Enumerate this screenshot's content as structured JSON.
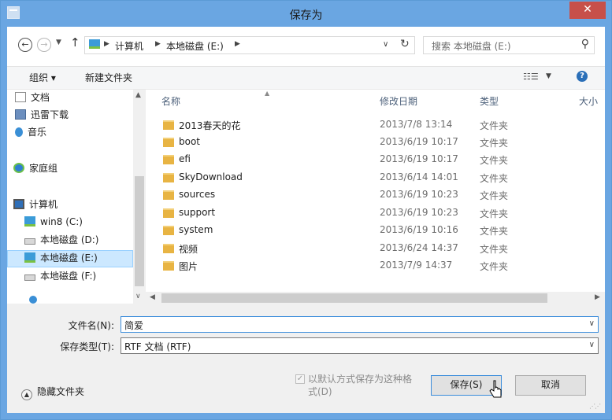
{
  "window": {
    "title": "保存为",
    "close_glyph": "✕"
  },
  "address_bar": {
    "path": [
      "计算机",
      "本地磁盘 (E:)"
    ],
    "search_placeholder": "搜索 本地磁盘 (E:)"
  },
  "toolbar": {
    "organize": "组织 ▾",
    "new_folder": "新建文件夹"
  },
  "nav_pane": {
    "items": [
      {
        "label": "文档",
        "icon": "document-icon"
      },
      {
        "label": "迅雷下载",
        "icon": "download-folder-icon"
      },
      {
        "label": "音乐",
        "icon": "music-icon"
      },
      {
        "label": "家庭组",
        "icon": "homegroup-icon"
      },
      {
        "label": "计算机",
        "icon": "computer-icon"
      },
      {
        "label": "win8 (C:)",
        "icon": "system-drive-icon"
      },
      {
        "label": "本地磁盘 (D:)",
        "icon": "drive-icon"
      },
      {
        "label": "本地磁盘 (E:)",
        "icon": "drive-icon",
        "selected": true
      },
      {
        "label": "本地磁盘 (F:)",
        "icon": "drive-icon"
      }
    ]
  },
  "file_list": {
    "columns": [
      "名称",
      "修改日期",
      "类型",
      "大小"
    ],
    "rows": [
      {
        "name": "2013春天的花",
        "date": "2013/7/8 13:14",
        "type": "文件夹"
      },
      {
        "name": "boot",
        "date": "2013/6/19 10:17",
        "type": "文件夹"
      },
      {
        "name": "efi",
        "date": "2013/6/19 10:17",
        "type": "文件夹"
      },
      {
        "name": "SkyDownload",
        "date": "2013/6/14 14:01",
        "type": "文件夹"
      },
      {
        "name": "sources",
        "date": "2013/6/19 10:23",
        "type": "文件夹"
      },
      {
        "name": "support",
        "date": "2013/6/19 10:23",
        "type": "文件夹"
      },
      {
        "name": "system",
        "date": "2013/6/19 10:16",
        "type": "文件夹"
      },
      {
        "name": "视频",
        "date": "2013/6/24 14:37",
        "type": "文件夹"
      },
      {
        "name": "图片",
        "date": "2013/7/9 14:37",
        "type": "文件夹"
      }
    ]
  },
  "form": {
    "filename_label": "文件名(N):",
    "filename_value": "简爱",
    "filetype_label": "保存类型(T):",
    "filetype_value": "RTF 文档 (RTF)"
  },
  "footer": {
    "hide_folders": "隐藏文件夹",
    "default_format_line1": "以默认方式保存为这种格",
    "default_format_line2": "式(D)",
    "save": "保存(S)",
    "cancel": "取消"
  },
  "colors": {
    "title_bar": "#6aa6e2",
    "close_button": "#c7504a",
    "selection": "#cce8ff",
    "accent": "#3c8ddb"
  }
}
